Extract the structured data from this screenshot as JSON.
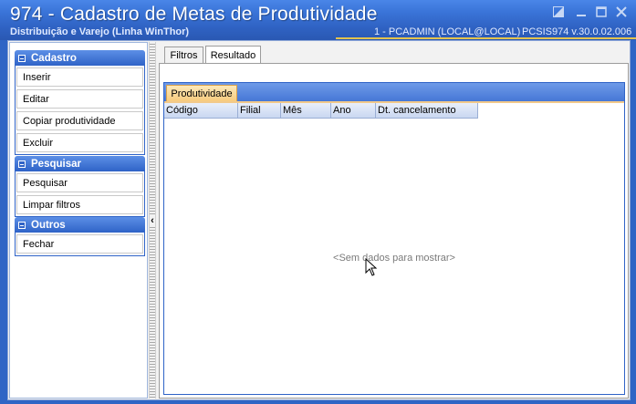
{
  "window": {
    "title": "974 - Cadastro de Metas de Produtividade",
    "subtitle": "Distribuição e Varejo (Linha WinThor)",
    "user_info": "1 - PCADMIN (LOCAL@LOCAL)",
    "version_info": "PCSIS974  v.30.0.02.006",
    "buttons": {
      "restore": "restore-icon",
      "minimize": "minimize-icon",
      "maximize": "maximize-icon",
      "close": "close-icon"
    }
  },
  "sidebar": {
    "groups": [
      {
        "title": "Cadastro",
        "items": [
          "Inserir",
          "Editar",
          "Copiar produtividade",
          "Excluir"
        ]
      },
      {
        "title": "Pesquisar",
        "items": [
          "Pesquisar",
          "Limpar filtros"
        ]
      },
      {
        "title": "Outros",
        "items": [
          "Fechar"
        ]
      }
    ]
  },
  "tabs": [
    {
      "label": "Filtros",
      "active": false
    },
    {
      "label": "Resultado",
      "active": true
    }
  ],
  "result": {
    "subtab": "Produtividade",
    "columns": [
      "Código",
      "Filial",
      "Mês",
      "Ano",
      "Dt. cancelamento"
    ],
    "empty_message": "<Sem dados para mostrar>"
  },
  "colors": {
    "title_bar": "#2f62c2",
    "group_header": "#2f63c7",
    "subtab_active": "#f7c97a",
    "info_underline": "#e3c34e"
  }
}
